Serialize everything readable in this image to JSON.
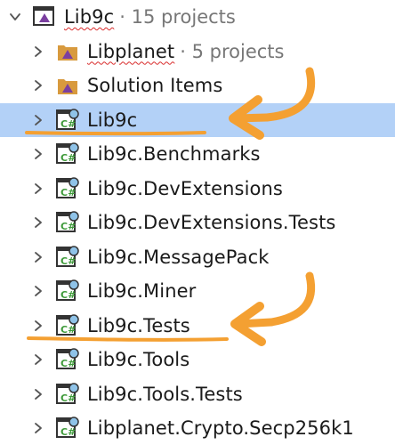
{
  "colors": {
    "selection": "#b3d1f7",
    "annotation": "#f4a032",
    "folder": "#d89a3e",
    "vs_purple": "#7b3fa0",
    "csharp_green": "#3e9a3a",
    "spell_error": "#d92b2b"
  },
  "tree": [
    {
      "label": "Lib9c",
      "meta": "· 15 projects",
      "icon": "solution-icon",
      "expanded": true,
      "selected": false,
      "squiggle": true
    },
    {
      "label": "Libplanet",
      "meta": "· 5 projects",
      "icon": "solution-folder-icon",
      "expanded": false,
      "selected": false,
      "squiggle": true
    },
    {
      "label": "Solution Items",
      "meta": "",
      "icon": "solution-folder-icon",
      "expanded": false,
      "selected": false,
      "squiggle": false
    },
    {
      "label": "Lib9c",
      "meta": "",
      "icon": "csharp-project-icon",
      "expanded": false,
      "selected": true,
      "squiggle": false
    },
    {
      "label": "Lib9c.Benchmarks",
      "meta": "",
      "icon": "csharp-project-icon",
      "expanded": false,
      "selected": false,
      "squiggle": false
    },
    {
      "label": "Lib9c.DevExtensions",
      "meta": "",
      "icon": "csharp-project-icon",
      "expanded": false,
      "selected": false,
      "squiggle": false
    },
    {
      "label": "Lib9c.DevExtensions.Tests",
      "meta": "",
      "icon": "csharp-project-icon",
      "expanded": false,
      "selected": false,
      "squiggle": false
    },
    {
      "label": "Lib9c.MessagePack",
      "meta": "",
      "icon": "csharp-project-icon",
      "expanded": false,
      "selected": false,
      "squiggle": false
    },
    {
      "label": "Lib9c.Miner",
      "meta": "",
      "icon": "csharp-project-icon",
      "expanded": false,
      "selected": false,
      "squiggle": false
    },
    {
      "label": "Lib9c.Tests",
      "meta": "",
      "icon": "csharp-project-icon",
      "expanded": false,
      "selected": false,
      "squiggle": false
    },
    {
      "label": "Lib9c.Tools",
      "meta": "",
      "icon": "csharp-project-icon",
      "expanded": false,
      "selected": false,
      "squiggle": false
    },
    {
      "label": "Lib9c.Tools.Tests",
      "meta": "",
      "icon": "csharp-project-icon",
      "expanded": false,
      "selected": false,
      "squiggle": false
    },
    {
      "label": "Libplanet.Crypto.Secp256k1",
      "meta": "",
      "icon": "csharp-project-icon",
      "expanded": false,
      "selected": false,
      "squiggle": false
    }
  ],
  "annotations": [
    {
      "icon": "hand-drawn-arrow-icon",
      "points_to": "Lib9c"
    },
    {
      "icon": "hand-drawn-arrow-icon",
      "points_to": "Lib9c.Tests"
    }
  ]
}
